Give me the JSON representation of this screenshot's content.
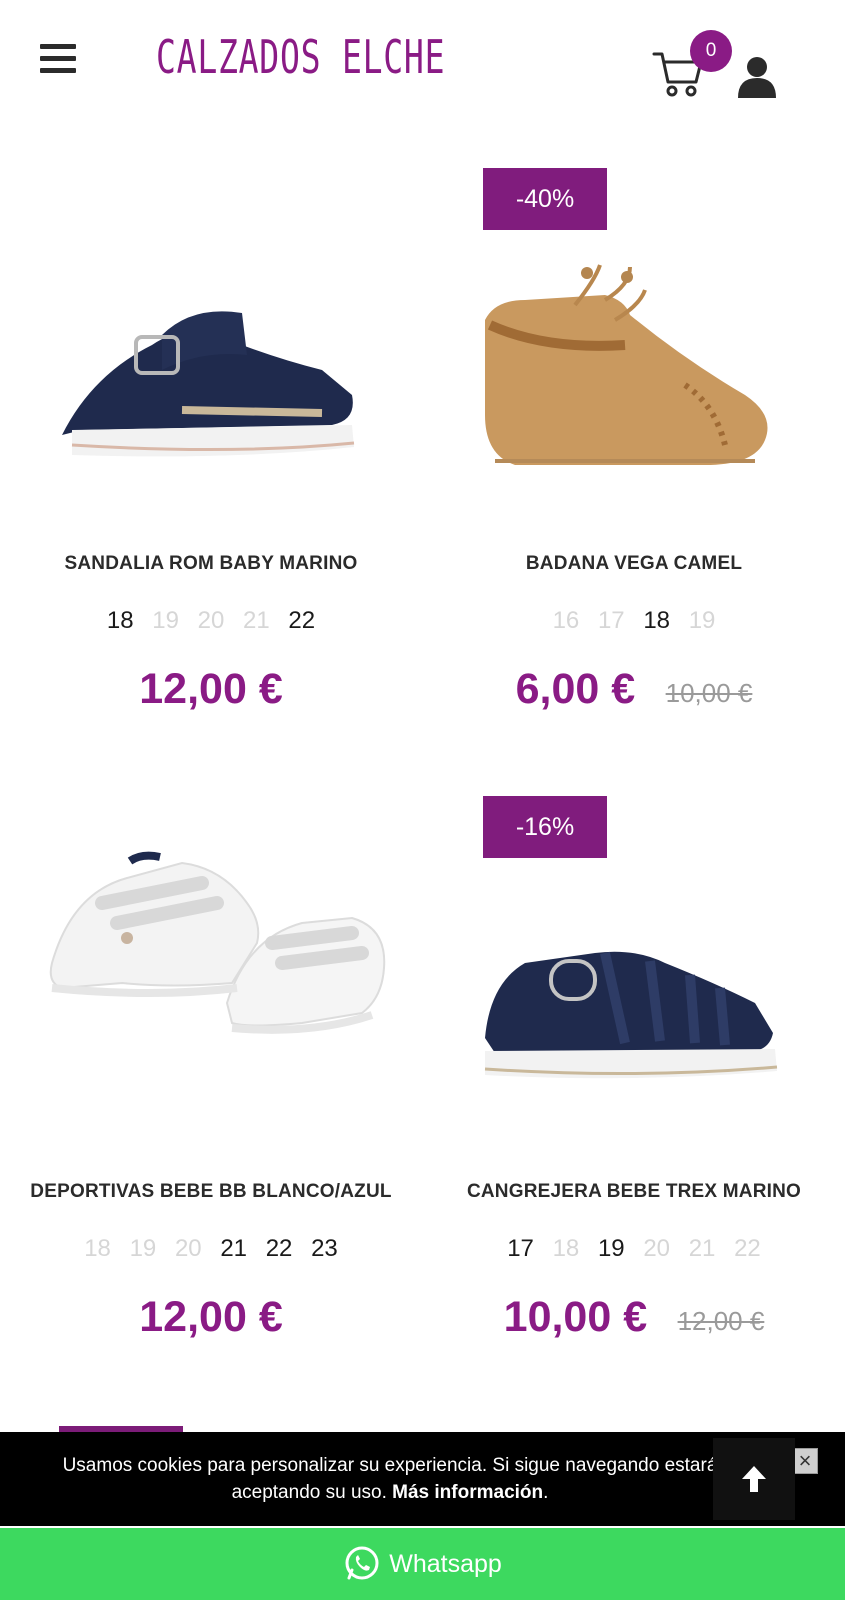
{
  "header": {
    "logo_text": "CALZADOS ELCHE",
    "cart_count": "0"
  },
  "colors": {
    "brand": "#8a1b85",
    "discount_badge": "#801c7d",
    "whatsapp": "#3dd95f"
  },
  "products": [
    {
      "title": "SANDALIA ROM BABY MARINO",
      "discount": "",
      "sizes": [
        {
          "label": "18",
          "available": true
        },
        {
          "label": "19",
          "available": false
        },
        {
          "label": "20",
          "available": false
        },
        {
          "label": "21",
          "available": false
        },
        {
          "label": "22",
          "available": true
        }
      ],
      "price": "12,00 €",
      "old_price": ""
    },
    {
      "title": "BADANA VEGA CAMEL",
      "discount": "-40%",
      "sizes": [
        {
          "label": "16",
          "available": false
        },
        {
          "label": "17",
          "available": false
        },
        {
          "label": "18",
          "available": true
        },
        {
          "label": "19",
          "available": false
        }
      ],
      "price": "6,00 €",
      "old_price": "10,00 €"
    },
    {
      "title": "DEPORTIVAS BEBE BB BLANCO/AZUL",
      "discount": "",
      "sizes": [
        {
          "label": "18",
          "available": false
        },
        {
          "label": "19",
          "available": false
        },
        {
          "label": "20",
          "available": false
        },
        {
          "label": "21",
          "available": true
        },
        {
          "label": "22",
          "available": true
        },
        {
          "label": "23",
          "available": true
        }
      ],
      "price": "12,00 €",
      "old_price": ""
    },
    {
      "title": "CANGREJERA BEBE TREX MARINO",
      "discount": "-16%",
      "sizes": [
        {
          "label": "17",
          "available": true
        },
        {
          "label": "18",
          "available": false
        },
        {
          "label": "19",
          "available": true
        },
        {
          "label": "20",
          "available": false
        },
        {
          "label": "21",
          "available": false
        },
        {
          "label": "22",
          "available": false
        }
      ],
      "price": "10,00 €",
      "old_price": "12,00 €"
    }
  ],
  "cookie_banner": {
    "text": "Usamos cookies para personalizar su experiencia. Si sigue navegando estará aceptando su uso.",
    "link_label": "Más información",
    "close_icon": "close-icon"
  },
  "whatsapp": {
    "label": "Whatsapp"
  }
}
